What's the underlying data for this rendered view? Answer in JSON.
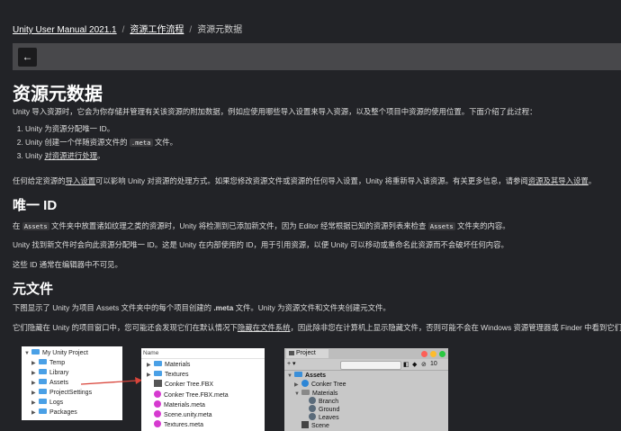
{
  "breadcrumb": {
    "root": "Unity User Manual 2021.1",
    "parent": "资源工作流程",
    "current": "资源元数据"
  },
  "toolbar": {
    "back_label": "←"
  },
  "page": {
    "title": "资源元数据",
    "intro": "Unity 导入资源时，它会为你存储并管理有关该资源的附加数据，例如应使用哪些导入设置来导入资源，以及整个项目中资源的使用位置。下面介绍了此过程：",
    "steps": [
      {
        "a": "Unity 为资源分配唯一 ID。",
        "code": "",
        "b": "",
        "link": ""
      },
      {
        "a": "Unity 创建一个伴随资源文件的 ",
        "code": ".meta",
        "b": " 文件。",
        "link": ""
      },
      {
        "a": "Unity ",
        "code": "",
        "b": "",
        "link": "对资源进行处理",
        "c": "。"
      }
    ],
    "import_para_a": "任何给定资源的",
    "import_para_link": "导入设置",
    "import_para_b": "可以影响 Unity 对资源的处理方式。如果您修改资源文件或资源的任何导入设置，Unity 将重新导入该资源。有关更多信息，请参阅",
    "import_para_link2": "资源及其导入设置",
    "import_para_c": "。",
    "h_uid": "唯一 ID",
    "uid_p1_a": "在 ",
    "uid_p1_code1": "Assets",
    "uid_p1_b": " 文件夹中放置诸如纹理之类的资源时，Unity 将检测到已添加新文件，因为 Editor 经常根据已知的资源列表来检查 ",
    "uid_p1_code2": "Assets",
    "uid_p1_c": " 文件夹的内容。",
    "uid_p2": "Unity 找到新文件时会向此资源分配唯一 ID。这是 Unity 在内部使用的 ID，用于引用资源，以便 Unity 可以移动或重命名此资源而不会破坏任何内容。",
    "uid_p3": "这些 ID 通常在编辑器中不可见。",
    "h_meta": "元文件",
    "meta_p1_a": "下图显示了 Unity 为项目 Assets 文件夹中的每个项目创建的 ",
    "meta_p1_bold": ".meta",
    "meta_p1_b": " 文件。Unity 为资源文件和文件夹创建元文件。",
    "meta_p2_a": "它们隐藏在 Unity 的项目窗口中，您可能还会发现它们在默认情况下",
    "meta_p2_link": "隐藏在文件系统",
    "meta_p2_b": "，因此除非您在计算机上显示隐藏文件，否则可能不会在 Windows 资源管理器或 Finder 中看到它们。"
  },
  "fig1": {
    "items": [
      {
        "label": "My Unity Project",
        "level": 0,
        "arrow": "▼"
      },
      {
        "label": "Temp",
        "level": 1,
        "arrow": "▶"
      },
      {
        "label": "Library",
        "level": 1,
        "arrow": "▶"
      },
      {
        "label": "Assets",
        "level": 1,
        "arrow": "▶"
      },
      {
        "label": "ProjectSettings",
        "level": 1,
        "arrow": "▶"
      },
      {
        "label": "Logs",
        "level": 1,
        "arrow": "▶"
      },
      {
        "label": "Packages",
        "level": 1,
        "arrow": "▶"
      }
    ]
  },
  "fig2": {
    "header": "Name",
    "items": [
      {
        "label": "Materials",
        "type": "folder"
      },
      {
        "label": "Textures",
        "type": "folder"
      },
      {
        "label": "Conker Tree.FBX",
        "type": "fbx"
      },
      {
        "label": "Conker Tree.FBX.meta",
        "type": "meta"
      },
      {
        "label": "Materials.meta",
        "type": "meta"
      },
      {
        "label": "Scene.unity.meta",
        "type": "meta"
      },
      {
        "label": "Textures.meta",
        "type": "meta"
      }
    ]
  },
  "fig3": {
    "tab": "Project",
    "add": "+ ▾",
    "count": "10",
    "items": [
      {
        "label": "Assets",
        "level": 0,
        "arrow": "▼",
        "bold": true
      },
      {
        "label": "Conker Tree",
        "level": 1,
        "arrow": "▶"
      },
      {
        "label": "Materials",
        "level": 1,
        "arrow": "▼"
      },
      {
        "label": "Branch",
        "level": 2,
        "arrow": ""
      },
      {
        "label": "Ground",
        "level": 2,
        "arrow": ""
      },
      {
        "label": "Leaves",
        "level": 2,
        "arrow": ""
      },
      {
        "label": "Scene",
        "level": 1,
        "arrow": ""
      }
    ]
  },
  "colors": {
    "background": "#222327",
    "toolbar": "#48484b",
    "arrow": "#d9443a",
    "traffic_red": "#fc5f57",
    "traffic_yellow": "#fdbc2e",
    "traffic_green": "#29c841"
  }
}
